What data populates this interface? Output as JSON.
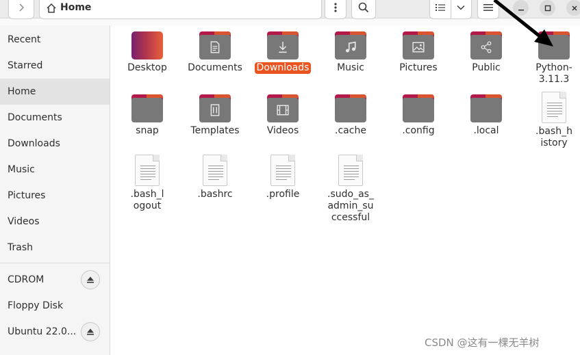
{
  "window": {
    "title": "Home",
    "watermark": "CSDN @这有一棵无羊树",
    "accent": "#e95420"
  },
  "sidebar": {
    "items": [
      {
        "label": "Recent"
      },
      {
        "label": "Starred"
      },
      {
        "label": "Home"
      },
      {
        "label": "Documents"
      },
      {
        "label": "Downloads"
      },
      {
        "label": "Music"
      },
      {
        "label": "Pictures"
      },
      {
        "label": "Videos"
      },
      {
        "label": "Trash"
      }
    ],
    "devices": [
      {
        "label": "CDROM"
      },
      {
        "label": "Floppy Disk"
      },
      {
        "label": "Ubuntu 22.0..."
      }
    ]
  },
  "files": [
    {
      "name": "Desktop",
      "icon": "desktop-folder-icon"
    },
    {
      "name": "Documents",
      "icon": "documents-folder-icon"
    },
    {
      "name": "Downloads",
      "icon": "downloads-folder-icon"
    },
    {
      "name": "Music",
      "icon": "music-folder-icon"
    },
    {
      "name": "Pictures",
      "icon": "pictures-folder-icon"
    },
    {
      "name": "Public",
      "icon": "public-folder-icon"
    },
    {
      "name": "Python-3.11.3",
      "icon": "folder-icon"
    },
    {
      "name": "snap",
      "icon": "folder-icon"
    },
    {
      "name": "Templates",
      "icon": "templates-folder-icon"
    },
    {
      "name": "Videos",
      "icon": "videos-folder-icon"
    },
    {
      "name": ".cache",
      "icon": "folder-icon"
    },
    {
      "name": ".config",
      "icon": "folder-icon"
    },
    {
      "name": ".local",
      "icon": "folder-icon"
    },
    {
      "name": ".bash_history",
      "icon": "text-file-icon"
    },
    {
      "name": ".bash_logout",
      "icon": "text-file-icon"
    },
    {
      "name": ".bashrc",
      "icon": "text-file-icon"
    },
    {
      "name": ".profile",
      "icon": "text-file-icon"
    },
    {
      "name": ".sudo_as_admin_successful",
      "icon": "text-file-icon"
    }
  ]
}
